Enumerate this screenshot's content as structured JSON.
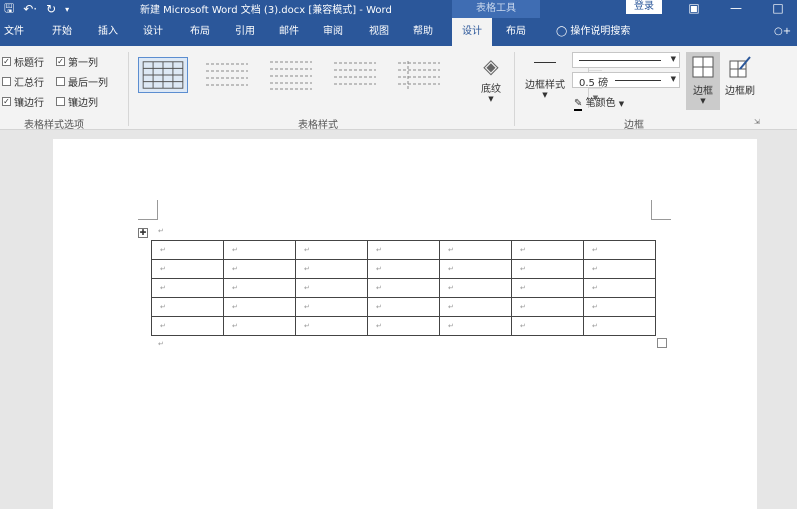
{
  "window": {
    "title": "新建 Microsoft Word 文档 (3).docx [兼容模式] - Word",
    "context_tab_group": "表格工具",
    "login_label": "登录"
  },
  "tabs": [
    "文件",
    "开始",
    "插入",
    "设计",
    "布局",
    "引用",
    "邮件",
    "审阅",
    "视图",
    "帮助",
    "设计",
    "布局"
  ],
  "active_tab_index": 10,
  "tell_me": "操作说明搜索",
  "table_style_options": {
    "items": [
      {
        "label": "标题行",
        "checked": true
      },
      {
        "label": "第一列",
        "checked": true
      },
      {
        "label": "汇总行",
        "checked": false
      },
      {
        "label": "最后一列",
        "checked": false
      },
      {
        "label": "镶边行",
        "checked": true
      },
      {
        "label": "镶边列",
        "checked": false
      }
    ],
    "group_label": "表格样式选项"
  },
  "table_styles": {
    "group_label": "表格样式",
    "shading_label": "底纹"
  },
  "borders": {
    "border_styles_label": "边框样式",
    "pen_weight": "0.5 磅",
    "pen_color_label": "笔颜色",
    "borders_label": "边框",
    "border_painter_label": "边框刷",
    "group_label": "边框"
  },
  "document": {
    "table": {
      "rows": 5,
      "cols": 7,
      "cell_mark": "↵"
    },
    "paragraph_mark": "↵"
  },
  "colors": {
    "title_bar": "#2b579a",
    "ribbon": "#f3f3f3",
    "canvas": "#e6e6e6"
  }
}
